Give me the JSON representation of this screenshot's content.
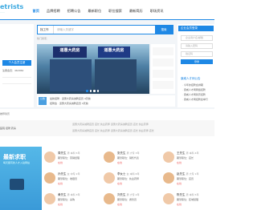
{
  "logo": {
    "text": "etrists",
    "sub": "......"
  },
  "nav": [
    "首页",
    "品牌招聘",
    "招聘公告",
    "最新职位",
    "职位搜索",
    "最新简历",
    "职场资讯"
  ],
  "left": {
    "button": "个人会员注册",
    "line": "注册会员：462962"
  },
  "search": {
    "select": "找工作",
    "placeholder": "请输入关键字",
    "button": "搜索"
  },
  "hot": "热门搜索：",
  "banner": {
    "sign1": "道惠大药房",
    "sign2": "道惠大药房"
  },
  "notice": {
    "badge": "公告",
    "line1": "最新招聘 · 道惠大药房诚聘店员 4天前",
    "line2": "招聘会 · 道惠大药房诚聘店员 4天前"
  },
  "right": {
    "head": "企业会员登录",
    "user_ph": "企业用户名/邮箱",
    "pass_ph": "请输入密码",
    "code_ph": "验证码",
    "login": "登录",
    "title": "康威人才网公告",
    "items": [
      "· 今年的招聘会排期",
      "· 康威人才网网络招聘",
      "· 康威人才网简历招聘",
      "· 康威人才网招聘会举行"
    ]
  },
  "section": "推荐简历",
  "grayband": [
    "道惠大药房诚聘店员 店长 执业药师 道惠大药房诚聘店员 店长 执业药师",
    "道惠大药房诚聘店员 店长 执业药师 道惠大药房诚聘店员 店长 执业药师 店长"
  ],
  "promo": {
    "t1": "最新求职",
    "t2": "每天都有新人才入驻网站"
  },
  "cards": [
    {
      "name": "周先生",
      "tag": "男 本科 5年",
      "info": "期望职位：营销经理",
      "rate": "在线"
    },
    {
      "name": "张先生",
      "tag": "男 大专 3年",
      "info": "期望职位：销售代表",
      "rate": "在线"
    },
    {
      "name": "王先生",
      "tag": "男 本科 4年",
      "info": "期望职位：店长",
      "rate": "在线"
    },
    {
      "name": "孙先生",
      "tag": "女 中专 2年",
      "info": "期望职位：收银员",
      "rate": "在线"
    },
    {
      "name": "李女士",
      "tag": "女 本科 6年",
      "info": "期望职位：执业药师",
      "rate": "在线"
    },
    {
      "name": "赵先生",
      "tag": "男 大专 1年",
      "info": "期望职位：店员",
      "rate": "在线"
    },
    {
      "name": "黄先生",
      "tag": "男 本科 3年",
      "info": "期望职位：采购",
      "rate": "在线"
    },
    {
      "name": "刘先生",
      "tag": "男 大专 2年",
      "info": "期望职位：质管员",
      "rate": "在线"
    },
    {
      "name": "陈先生",
      "tag": "男 本科 5年",
      "info": "期望职位：区域经理",
      "rate": "在线"
    }
  ],
  "leftlinks": "医院 招聘 药房"
}
